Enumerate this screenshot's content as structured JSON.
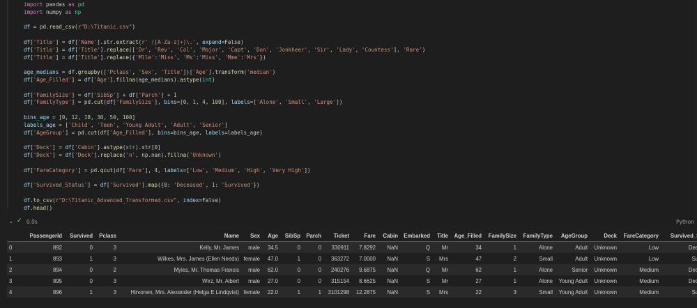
{
  "code": {
    "lines": [
      [
        {
          "t": "import",
          "c": "kw"
        },
        {
          "t": " pandas ",
          "c": ""
        },
        {
          "t": "as",
          "c": "kw"
        },
        {
          "t": " pd",
          "c": "cls"
        }
      ],
      [
        {
          "t": "import",
          "c": "kw"
        },
        {
          "t": " numpy ",
          "c": ""
        },
        {
          "t": "as",
          "c": "kw"
        },
        {
          "t": " np",
          "c": "cls"
        }
      ],
      [],
      [
        {
          "t": "df",
          "c": "var"
        },
        {
          "t": " = pd.",
          "c": ""
        },
        {
          "t": "read_csv",
          "c": "fn"
        },
        {
          "t": "(",
          "c": ""
        },
        {
          "t": "r\"D:\\Titanic.csv\"",
          "c": "str"
        },
        {
          "t": ")",
          "c": ""
        }
      ],
      [],
      [
        {
          "t": "df",
          "c": "var"
        },
        {
          "t": "[",
          "c": ""
        },
        {
          "t": "'Title'",
          "c": "str"
        },
        {
          "t": "] = ",
          "c": ""
        },
        {
          "t": "df",
          "c": "var"
        },
        {
          "t": "[",
          "c": ""
        },
        {
          "t": "'Name'",
          "c": "str"
        },
        {
          "t": "].str.",
          "c": ""
        },
        {
          "t": "extract",
          "c": "fn"
        },
        {
          "t": "(",
          "c": ""
        },
        {
          "t": "r' ([A-Za-z]+)\\.'",
          "c": "str"
        },
        {
          "t": ", ",
          "c": ""
        },
        {
          "t": "expand",
          "c": "var"
        },
        {
          "t": "=False)",
          "c": ""
        }
      ],
      [
        {
          "t": "df",
          "c": "var"
        },
        {
          "t": "[",
          "c": ""
        },
        {
          "t": "'Title'",
          "c": "str"
        },
        {
          "t": "] = ",
          "c": ""
        },
        {
          "t": "df",
          "c": "var"
        },
        {
          "t": "[",
          "c": ""
        },
        {
          "t": "'Title'",
          "c": "str"
        },
        {
          "t": "].",
          "c": ""
        },
        {
          "t": "replace",
          "c": "fn"
        },
        {
          "t": "([",
          "c": ""
        },
        {
          "t": "'Dr'",
          "c": "str"
        },
        {
          "t": ", ",
          "c": ""
        },
        {
          "t": "'Rev'",
          "c": "str"
        },
        {
          "t": ", ",
          "c": ""
        },
        {
          "t": "'Col'",
          "c": "str"
        },
        {
          "t": ", ",
          "c": ""
        },
        {
          "t": "'Major'",
          "c": "str"
        },
        {
          "t": ", ",
          "c": ""
        },
        {
          "t": "'Capt'",
          "c": "str"
        },
        {
          "t": ", ",
          "c": ""
        },
        {
          "t": "'Don'",
          "c": "str"
        },
        {
          "t": ", ",
          "c": ""
        },
        {
          "t": "'Jonkheer'",
          "c": "str"
        },
        {
          "t": ", ",
          "c": ""
        },
        {
          "t": "'Sir'",
          "c": "str"
        },
        {
          "t": ", ",
          "c": ""
        },
        {
          "t": "'Lady'",
          "c": "str"
        },
        {
          "t": ", ",
          "c": ""
        },
        {
          "t": "'Countess'",
          "c": "str"
        },
        {
          "t": "], ",
          "c": ""
        },
        {
          "t": "'Rare'",
          "c": "str"
        },
        {
          "t": ")",
          "c": ""
        }
      ],
      [
        {
          "t": "df",
          "c": "var"
        },
        {
          "t": "[",
          "c": ""
        },
        {
          "t": "'Title'",
          "c": "str"
        },
        {
          "t": "] = ",
          "c": ""
        },
        {
          "t": "df",
          "c": "var"
        },
        {
          "t": "[",
          "c": ""
        },
        {
          "t": "'Title'",
          "c": "str"
        },
        {
          "t": "].",
          "c": ""
        },
        {
          "t": "replace",
          "c": "fn"
        },
        {
          "t": "({",
          "c": ""
        },
        {
          "t": "'Mlle'",
          "c": "str"
        },
        {
          "t": ":",
          "c": ""
        },
        {
          "t": "'Miss'",
          "c": "str"
        },
        {
          "t": ", ",
          "c": ""
        },
        {
          "t": "'Ms'",
          "c": "str"
        },
        {
          "t": ":",
          "c": ""
        },
        {
          "t": "'Miss'",
          "c": "str"
        },
        {
          "t": ", ",
          "c": ""
        },
        {
          "t": "'Mme'",
          "c": "str"
        },
        {
          "t": ":",
          "c": ""
        },
        {
          "t": "'Mrs'",
          "c": "str"
        },
        {
          "t": "})",
          "c": ""
        }
      ],
      [],
      [
        {
          "t": "age_medians",
          "c": "var"
        },
        {
          "t": " = df.",
          "c": ""
        },
        {
          "t": "groupby",
          "c": "fn"
        },
        {
          "t": "([",
          "c": ""
        },
        {
          "t": "'Pclass'",
          "c": "str"
        },
        {
          "t": ", ",
          "c": ""
        },
        {
          "t": "'Sex'",
          "c": "str"
        },
        {
          "t": ", ",
          "c": ""
        },
        {
          "t": "'Title'",
          "c": "str"
        },
        {
          "t": "])[",
          "c": ""
        },
        {
          "t": "'Age'",
          "c": "str"
        },
        {
          "t": "].",
          "c": ""
        },
        {
          "t": "transform",
          "c": "fn"
        },
        {
          "t": "(",
          "c": ""
        },
        {
          "t": "'median'",
          "c": "str"
        },
        {
          "t": ")",
          "c": ""
        }
      ],
      [
        {
          "t": "df",
          "c": "var"
        },
        {
          "t": "[",
          "c": ""
        },
        {
          "t": "'Age_Filled'",
          "c": "str"
        },
        {
          "t": "] = ",
          "c": ""
        },
        {
          "t": "df",
          "c": "var"
        },
        {
          "t": "[",
          "c": ""
        },
        {
          "t": "'Age'",
          "c": "str"
        },
        {
          "t": "].",
          "c": ""
        },
        {
          "t": "fillna",
          "c": "fn"
        },
        {
          "t": "(age_medians).",
          "c": ""
        },
        {
          "t": "astype",
          "c": "fn"
        },
        {
          "t": "(",
          "c": ""
        },
        {
          "t": "int",
          "c": "cls"
        },
        {
          "t": ")",
          "c": ""
        }
      ],
      [],
      [
        {
          "t": "df",
          "c": "var"
        },
        {
          "t": "[",
          "c": ""
        },
        {
          "t": "'FamilySize'",
          "c": "str"
        },
        {
          "t": "] = ",
          "c": ""
        },
        {
          "t": "df",
          "c": "var"
        },
        {
          "t": "[",
          "c": ""
        },
        {
          "t": "'SibSp'",
          "c": "str"
        },
        {
          "t": "] + ",
          "c": ""
        },
        {
          "t": "df",
          "c": "var"
        },
        {
          "t": "[",
          "c": ""
        },
        {
          "t": "'Parch'",
          "c": "str"
        },
        {
          "t": "] + ",
          "c": ""
        },
        {
          "t": "1",
          "c": "num"
        }
      ],
      [
        {
          "t": "df",
          "c": "var"
        },
        {
          "t": "[",
          "c": ""
        },
        {
          "t": "'FamilyType'",
          "c": "str"
        },
        {
          "t": "] = pd.",
          "c": ""
        },
        {
          "t": "cut",
          "c": "fn"
        },
        {
          "t": "(df[",
          "c": ""
        },
        {
          "t": "'FamilySize'",
          "c": "str"
        },
        {
          "t": "], ",
          "c": ""
        },
        {
          "t": "bins",
          "c": "var"
        },
        {
          "t": "=[",
          "c": ""
        },
        {
          "t": "0",
          "c": "num"
        },
        {
          "t": ", ",
          "c": ""
        },
        {
          "t": "1",
          "c": "num"
        },
        {
          "t": ", ",
          "c": ""
        },
        {
          "t": "4",
          "c": "num"
        },
        {
          "t": ", ",
          "c": ""
        },
        {
          "t": "100",
          "c": "num"
        },
        {
          "t": "], ",
          "c": ""
        },
        {
          "t": "labels",
          "c": "var"
        },
        {
          "t": "=[",
          "c": ""
        },
        {
          "t": "'Alone'",
          "c": "str"
        },
        {
          "t": ", ",
          "c": ""
        },
        {
          "t": "'Small'",
          "c": "str"
        },
        {
          "t": ", ",
          "c": ""
        },
        {
          "t": "'Large'",
          "c": "str"
        },
        {
          "t": "])",
          "c": ""
        }
      ],
      [],
      [
        {
          "t": "bins_age",
          "c": "var"
        },
        {
          "t": " = [",
          "c": ""
        },
        {
          "t": "0",
          "c": "num"
        },
        {
          "t": ", ",
          "c": ""
        },
        {
          "t": "12",
          "c": "num"
        },
        {
          "t": ", ",
          "c": ""
        },
        {
          "t": "18",
          "c": "num"
        },
        {
          "t": ", ",
          "c": ""
        },
        {
          "t": "30",
          "c": "num"
        },
        {
          "t": ", ",
          "c": ""
        },
        {
          "t": "50",
          "c": "num"
        },
        {
          "t": ", ",
          "c": ""
        },
        {
          "t": "100",
          "c": "num"
        },
        {
          "t": "]",
          "c": ""
        }
      ],
      [
        {
          "t": "labels_age",
          "c": "var"
        },
        {
          "t": " = [",
          "c": ""
        },
        {
          "t": "'Child'",
          "c": "str"
        },
        {
          "t": ", ",
          "c": ""
        },
        {
          "t": "'Teen'",
          "c": "str"
        },
        {
          "t": ", ",
          "c": ""
        },
        {
          "t": "'Young Adult'",
          "c": "str"
        },
        {
          "t": ", ",
          "c": ""
        },
        {
          "t": "'Adult'",
          "c": "str"
        },
        {
          "t": ", ",
          "c": ""
        },
        {
          "t": "'Senior'",
          "c": "str"
        },
        {
          "t": "]",
          "c": ""
        }
      ],
      [
        {
          "t": "df",
          "c": "var"
        },
        {
          "t": "[",
          "c": ""
        },
        {
          "t": "'AgeGroup'",
          "c": "str"
        },
        {
          "t": "] = pd.",
          "c": ""
        },
        {
          "t": "cut",
          "c": "fn"
        },
        {
          "t": "(df[",
          "c": ""
        },
        {
          "t": "'Age_Filled'",
          "c": "str"
        },
        {
          "t": "], ",
          "c": ""
        },
        {
          "t": "bins",
          "c": "var"
        },
        {
          "t": "=bins_age, ",
          "c": ""
        },
        {
          "t": "labels",
          "c": "var"
        },
        {
          "t": "=labels_age)",
          "c": ""
        }
      ],
      [],
      [
        {
          "t": "df",
          "c": "var"
        },
        {
          "t": "[",
          "c": ""
        },
        {
          "t": "'Deck'",
          "c": "str"
        },
        {
          "t": "] = ",
          "c": ""
        },
        {
          "t": "df",
          "c": "var"
        },
        {
          "t": "[",
          "c": ""
        },
        {
          "t": "'Cabin'",
          "c": "str"
        },
        {
          "t": "].",
          "c": ""
        },
        {
          "t": "astype",
          "c": "fn"
        },
        {
          "t": "(",
          "c": ""
        },
        {
          "t": "str",
          "c": "cls"
        },
        {
          "t": ").str[",
          "c": ""
        },
        {
          "t": "0",
          "c": "num"
        },
        {
          "t": "]",
          "c": ""
        }
      ],
      [
        {
          "t": "df",
          "c": "var"
        },
        {
          "t": "[",
          "c": ""
        },
        {
          "t": "'Deck'",
          "c": "str"
        },
        {
          "t": "] = ",
          "c": ""
        },
        {
          "t": "df",
          "c": "var"
        },
        {
          "t": "[",
          "c": ""
        },
        {
          "t": "'Deck'",
          "c": "str"
        },
        {
          "t": "].",
          "c": ""
        },
        {
          "t": "replace",
          "c": "fn"
        },
        {
          "t": "(",
          "c": ""
        },
        {
          "t": "'n'",
          "c": "str"
        },
        {
          "t": ", np.nan).",
          "c": ""
        },
        {
          "t": "fillna",
          "c": "fn"
        },
        {
          "t": "(",
          "c": ""
        },
        {
          "t": "'Unknown'",
          "c": "str"
        },
        {
          "t": ")",
          "c": ""
        }
      ],
      [],
      [
        {
          "t": "df",
          "c": "var"
        },
        {
          "t": "[",
          "c": ""
        },
        {
          "t": "'FareCategory'",
          "c": "str"
        },
        {
          "t": "] = pd.",
          "c": ""
        },
        {
          "t": "qcut",
          "c": "fn"
        },
        {
          "t": "(df[",
          "c": ""
        },
        {
          "t": "'Fare'",
          "c": "str"
        },
        {
          "t": "], ",
          "c": ""
        },
        {
          "t": "4",
          "c": "num"
        },
        {
          "t": ", ",
          "c": ""
        },
        {
          "t": "labels",
          "c": "var"
        },
        {
          "t": "=[",
          "c": ""
        },
        {
          "t": "'Low'",
          "c": "str"
        },
        {
          "t": ", ",
          "c": ""
        },
        {
          "t": "'Medium'",
          "c": "str"
        },
        {
          "t": ", ",
          "c": ""
        },
        {
          "t": "'High'",
          "c": "str"
        },
        {
          "t": ", ",
          "c": ""
        },
        {
          "t": "'Very High'",
          "c": "str"
        },
        {
          "t": "])",
          "c": ""
        }
      ],
      [],
      [
        {
          "t": "df",
          "c": "var"
        },
        {
          "t": "[",
          "c": ""
        },
        {
          "t": "'Survived_Status'",
          "c": "str"
        },
        {
          "t": "] = ",
          "c": ""
        },
        {
          "t": "df",
          "c": "var"
        },
        {
          "t": "[",
          "c": ""
        },
        {
          "t": "'Survived'",
          "c": "str"
        },
        {
          "t": "].",
          "c": ""
        },
        {
          "t": "map",
          "c": "fn"
        },
        {
          "t": "({",
          "c": ""
        },
        {
          "t": "0",
          "c": "num"
        },
        {
          "t": ": ",
          "c": ""
        },
        {
          "t": "'Deceased'",
          "c": "str"
        },
        {
          "t": ", ",
          "c": ""
        },
        {
          "t": "1",
          "c": "num"
        },
        {
          "t": ": ",
          "c": ""
        },
        {
          "t": "'Survived'",
          "c": "str"
        },
        {
          "t": "})",
          "c": ""
        }
      ],
      [],
      [
        {
          "t": "df",
          "c": "var"
        },
        {
          "t": ".",
          "c": ""
        },
        {
          "t": "to_csv",
          "c": "fn"
        },
        {
          "t": "(",
          "c": ""
        },
        {
          "t": "r\"D:\\Titanic_Advanced_Transformed.csv\"",
          "c": "str"
        },
        {
          "t": ", ",
          "c": ""
        },
        {
          "t": "index",
          "c": "var"
        },
        {
          "t": "=False)",
          "c": ""
        }
      ],
      [
        {
          "t": "df",
          "c": "var"
        },
        {
          "t": ".",
          "c": ""
        },
        {
          "t": "head",
          "c": "fn"
        },
        {
          "t": "()",
          "c": ""
        }
      ]
    ]
  },
  "status": {
    "chevron": "⌄",
    "check": "✓",
    "time": "0.0s",
    "language": "Python"
  },
  "table": {
    "columns": [
      "",
      "PassengerId",
      "Survived",
      "Pclass",
      "Name",
      "Sex",
      "Age",
      "SibSp",
      "Parch",
      "Ticket",
      "Fare",
      "Cabin",
      "Embarked",
      "Title",
      "Age_Filled",
      "FamilySize",
      "FamilyType",
      "AgeGroup",
      "Deck",
      "FareCategory",
      "Survived_Status"
    ],
    "rows": [
      [
        "0",
        "892",
        "0",
        "3",
        "Kelly, Mr. James",
        "male",
        "34.5",
        "0",
        "0",
        "330911",
        "7.8292",
        "NaN",
        "Q",
        "Mr",
        "34",
        "1",
        "Alone",
        "Adult",
        "Unknown",
        "Low",
        "Deceased"
      ],
      [
        "1",
        "893",
        "1",
        "3",
        "Wilkes, Mrs. James (Ellen Needs)",
        "female",
        "47.0",
        "1",
        "0",
        "363272",
        "7.0000",
        "NaN",
        "S",
        "Mrs",
        "47",
        "2",
        "Small",
        "Adult",
        "Unknown",
        "Low",
        "Survived"
      ],
      [
        "2",
        "894",
        "0",
        "2",
        "Myles, Mr. Thomas Francis",
        "male",
        "62.0",
        "0",
        "0",
        "240276",
        "9.6875",
        "NaN",
        "Q",
        "Mr",
        "62",
        "1",
        "Alone",
        "Senior",
        "Unknown",
        "Medium",
        "Deceased"
      ],
      [
        "3",
        "895",
        "0",
        "3",
        "Wirz, Mr. Albert",
        "male",
        "27.0",
        "0",
        "0",
        "315154",
        "8.6625",
        "NaN",
        "S",
        "Mr",
        "27",
        "1",
        "Alone",
        "Young Adult",
        "Unknown",
        "Medium",
        "Deceased"
      ],
      [
        "4",
        "896",
        "1",
        "3",
        "Hirvonen, Mrs. Alexander (Helga E Lindqvist)",
        "female",
        "22.0",
        "1",
        "1",
        "3101298",
        "12.2875",
        "NaN",
        "S",
        "Mrs",
        "22",
        "3",
        "Small",
        "Young Adult",
        "Unknown",
        "Medium",
        "Survived"
      ]
    ]
  }
}
